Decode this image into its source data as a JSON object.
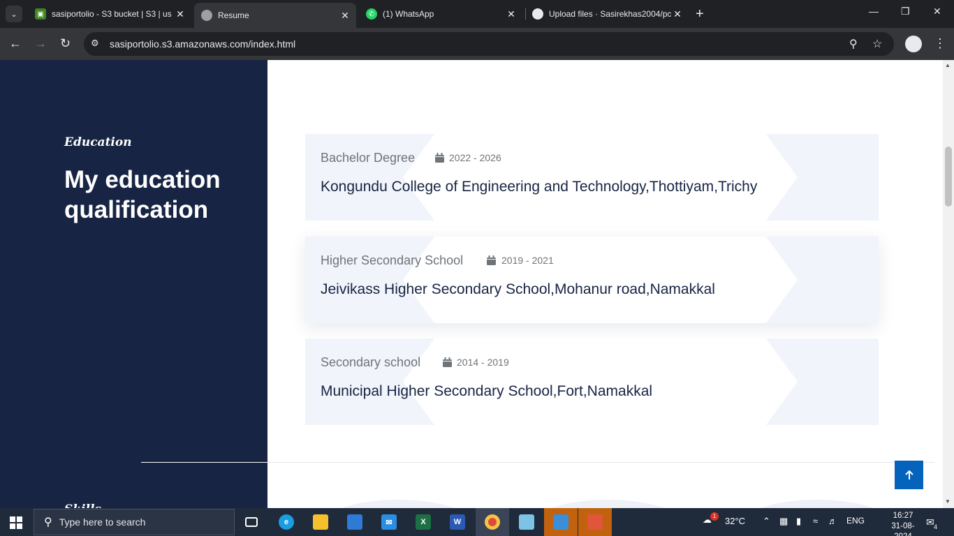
{
  "browser": {
    "tabs": [
      {
        "title": "sasiportolio - S3 bucket | S3 | us",
        "favicon": "aws-s3-icon",
        "active": false
      },
      {
        "title": "Resume",
        "favicon": "globe-icon",
        "active": true
      },
      {
        "title": "(1) WhatsApp",
        "favicon": "whatsapp-icon",
        "active": false
      },
      {
        "title": "Upload files · Sasirekhas2004/pc",
        "favicon": "github-icon",
        "active": false
      }
    ],
    "url": "sasiportolio.s3.amazonaws.com/index.html"
  },
  "page": {
    "section_subtitle": "Education",
    "section_title": "My education qualification",
    "next_section_subtitle": "Skills",
    "education": [
      {
        "degree": "Bachelor Degree",
        "years": "2022 - 2026",
        "institution": "Kongundu College of Engineering and Technology,Thottiyam,Trichy"
      },
      {
        "degree": "Higher Secondary School",
        "years": "2019 - 2021",
        "institution": "Jeivikass Higher Secondary School,Mohanur road,Namakkal"
      },
      {
        "degree": "Secondary school",
        "years": "2014 - 2019",
        "institution": "Municipal Higher Secondary School,Fort,Namakkal"
      }
    ],
    "colors": {
      "sidebar": "#172443",
      "accent": "#0563bb",
      "card": "#f1f4fa"
    }
  },
  "taskbar": {
    "search_placeholder": "Type here to search",
    "weather": "32°C",
    "weather_badge": "1",
    "language": "ENG",
    "time": "16:27",
    "date": "31-08-2024",
    "notification_count": "4"
  }
}
